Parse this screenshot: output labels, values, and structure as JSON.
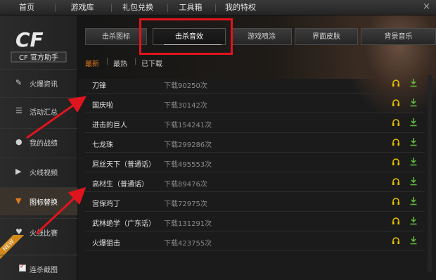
{
  "topnav": {
    "items": [
      "首页",
      "游戏库",
      "礼包兑换",
      "工具箱",
      "我的特权"
    ],
    "close": "×"
  },
  "sidebar": {
    "logo_text": "CF 官方助手",
    "items": [
      {
        "label": "火爆资讯",
        "icon": "news-icon"
      },
      {
        "label": "活动汇总",
        "icon": "list-icon"
      },
      {
        "label": "我的战绩",
        "icon": "user-icon"
      },
      {
        "label": "火线视频",
        "icon": "video-icon"
      },
      {
        "label": "图标替换",
        "icon": "shirt-icon"
      },
      {
        "label": "火线比赛",
        "icon": "shield-icon"
      },
      {
        "label": "连杀截图",
        "icon": "checkbox-icon"
      }
    ],
    "new_badge": "NEW"
  },
  "tabs": [
    "击杀图标",
    "击杀音效",
    "游戏喷涂",
    "界面皮肤",
    "背景音乐"
  ],
  "active_tab": "击杀音效",
  "subtabs": [
    "最新",
    "最热",
    "已下载"
  ],
  "sounds": [
    {
      "name": "刀锋",
      "downloads": "下载90250次"
    },
    {
      "name": "国庆啦",
      "downloads": "下载30142次"
    },
    {
      "name": "进击的巨人",
      "downloads": "下载154241次"
    },
    {
      "name": "七龙珠",
      "downloads": "下载299286次"
    },
    {
      "name": "屌丝天下（普通话）",
      "downloads": "下载495553次"
    },
    {
      "name": "高材生（普通话）",
      "downloads": "下载89476次"
    },
    {
      "name": "宫保鸡丁",
      "downloads": "下载72975次"
    },
    {
      "name": "武林绝学（广东话）",
      "downloads": "下载131291次"
    },
    {
      "name": "火爆狙击",
      "downloads": "下载423755次"
    }
  ],
  "colors": {
    "accent_red": "#e0141e",
    "headphone_yellow": "#e8c200",
    "download_green": "#5db83a",
    "highlight_orange": "#e07a1c"
  }
}
